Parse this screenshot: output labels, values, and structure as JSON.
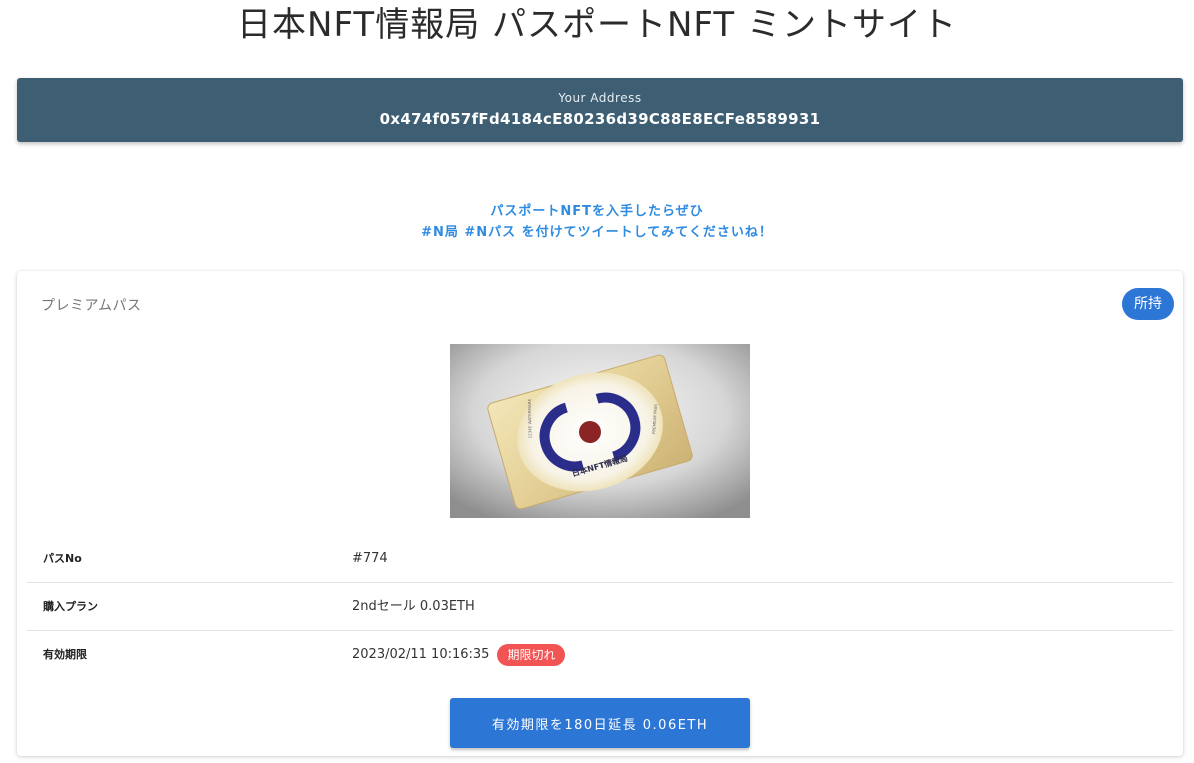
{
  "page": {
    "title": "日本NFT情報局 パスポートNFT ミントサイト"
  },
  "wallet": {
    "label": "Your Address",
    "address": "0x474f057fFd4184cE80236d39C88E8ECFe8589931"
  },
  "notice": {
    "line1": "パスポートNFTを入手したらぜひ",
    "line2": "#N局 #Nパス を付けてツイートしてみてくださいね！"
  },
  "card": {
    "title": "プレミアムパス",
    "owned_badge": "所持",
    "image": {
      "card_text": "日本NFT情報局",
      "edge_text_left": "12345 WATERMARK",
      "edge_text_right": "PREMIUM PASS",
      "brand_colors": [
        "#2b2d8a",
        "#8b2424",
        "#d9c48a"
      ]
    },
    "rows": [
      {
        "label": "パスNo",
        "value": "#774"
      },
      {
        "label": "購入プラン",
        "value": "2ndセール 0.03ETH"
      },
      {
        "label": "有効期限",
        "value": "2023/02/11 10:16:35",
        "badge": "期限切れ"
      }
    ],
    "extend_button": "有効期限を180日延長 0.06ETH"
  },
  "colors": {
    "header_bar": "#3e5f73",
    "accent_blue": "#2c76d6",
    "link_blue": "#2f8be0",
    "expired_red": "#f25454"
  }
}
